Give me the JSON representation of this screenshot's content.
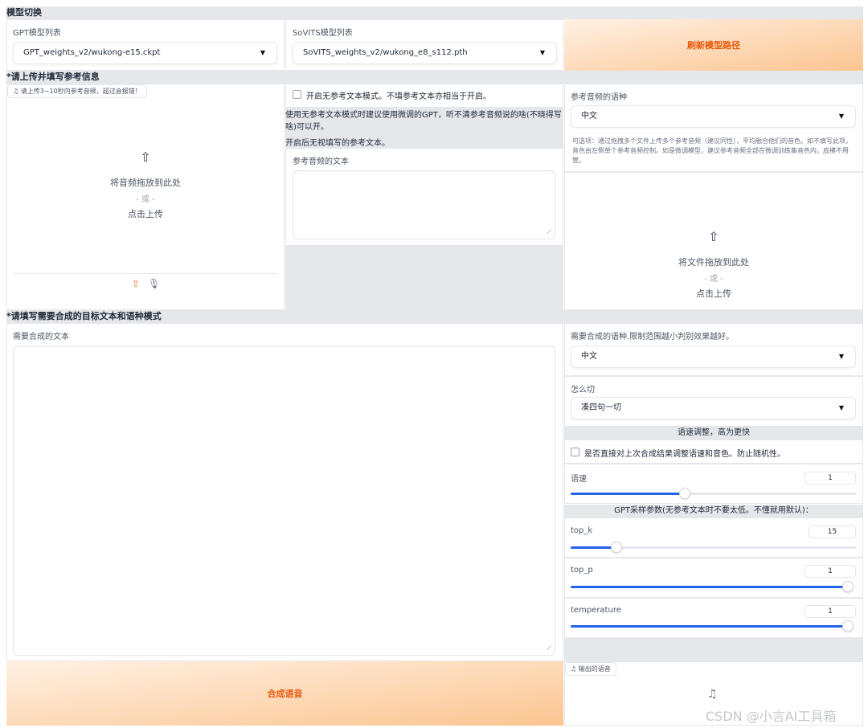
{
  "sections": {
    "model_switch": "模型切换",
    "reference": "*请上传并填写参考信息",
    "target": "*请填写需要合成的目标文本和语种模式"
  },
  "gpt_model": {
    "label": "GPT模型列表",
    "value": "GPT_weights_v2/wukong-e15.ckpt"
  },
  "sovits_model": {
    "label": "SoVITS模型列表",
    "value": "SoVITS_weights_v2/wukong_e8_s112.pth"
  },
  "refresh_button": "刷新模型路径",
  "ref_audio": {
    "chip": "请上传3~10秒内参考音频，超过会报错！",
    "drop_text": "将音频拖放到此处",
    "or_text": "- 或 -",
    "click_text": "点击上传"
  },
  "no_ref": {
    "checkbox_label": "开启无参考文本模式。不填参考文本亦相当于开启。",
    "info_line1": "使用无参考文本模式时建议使用微调的GPT，听不清参考音频说的啥(不晓得写啥)可以开。",
    "info_line2": "开启后无视填写的参考文本。"
  },
  "ref_text": {
    "label": "参考音频的文本",
    "value": ""
  },
  "ref_lang": {
    "label": "参考音频的语种",
    "value": "中文",
    "hint": "可选项：通过拖拽多个文件上传多个参考音频（建议同性），平均融合他们的音色。如不填写此项，音色由左侧单个参考音频控制。如是微调模型，建议参考音频全部在微调训练集音色内，底模不用管。"
  },
  "multi_upload": {
    "drop_text": "将文件拖放到此处",
    "or_text": "- 或 -",
    "click_text": "点击上传"
  },
  "target_text": {
    "label": "需要合成的文本",
    "value": ""
  },
  "target_lang": {
    "label": "需要合成的语种.限制范围越小判别效果越好。",
    "value": "中文"
  },
  "cut_method": {
    "label": "怎么切",
    "value": "凑四句一切"
  },
  "speed": {
    "header": "语速调整，高为更快",
    "checkbox_label": "是否直接对上次合成结果调整语速和音色。防止随机性。",
    "label": "语速",
    "value": "1",
    "fraction": 0.4
  },
  "gpt_params": {
    "header": "GPT采样参数(无参考文本时不要太低。不懂就用默认)：",
    "top_k": {
      "label": "top_k",
      "value": "15",
      "fraction": 0.16
    },
    "top_p": {
      "label": "top_p",
      "value": "1",
      "fraction": 1.0
    },
    "temperature": {
      "label": "temperature",
      "value": "1",
      "fraction": 1.0
    }
  },
  "synth_button": "合成语音",
  "output": {
    "chip": "输出的语音"
  },
  "watermark": "CSDN @小言AI工具箱",
  "colors": {
    "accent": "#2563eb",
    "button_text": "#ea580c",
    "button_start": "#fff1e3",
    "button_end": "#fbc591",
    "section_bg": "#e5e7eb"
  },
  "icons": [
    "upload-icon",
    "microphone-icon",
    "music-note-icon",
    "chevron-down-icon"
  ]
}
